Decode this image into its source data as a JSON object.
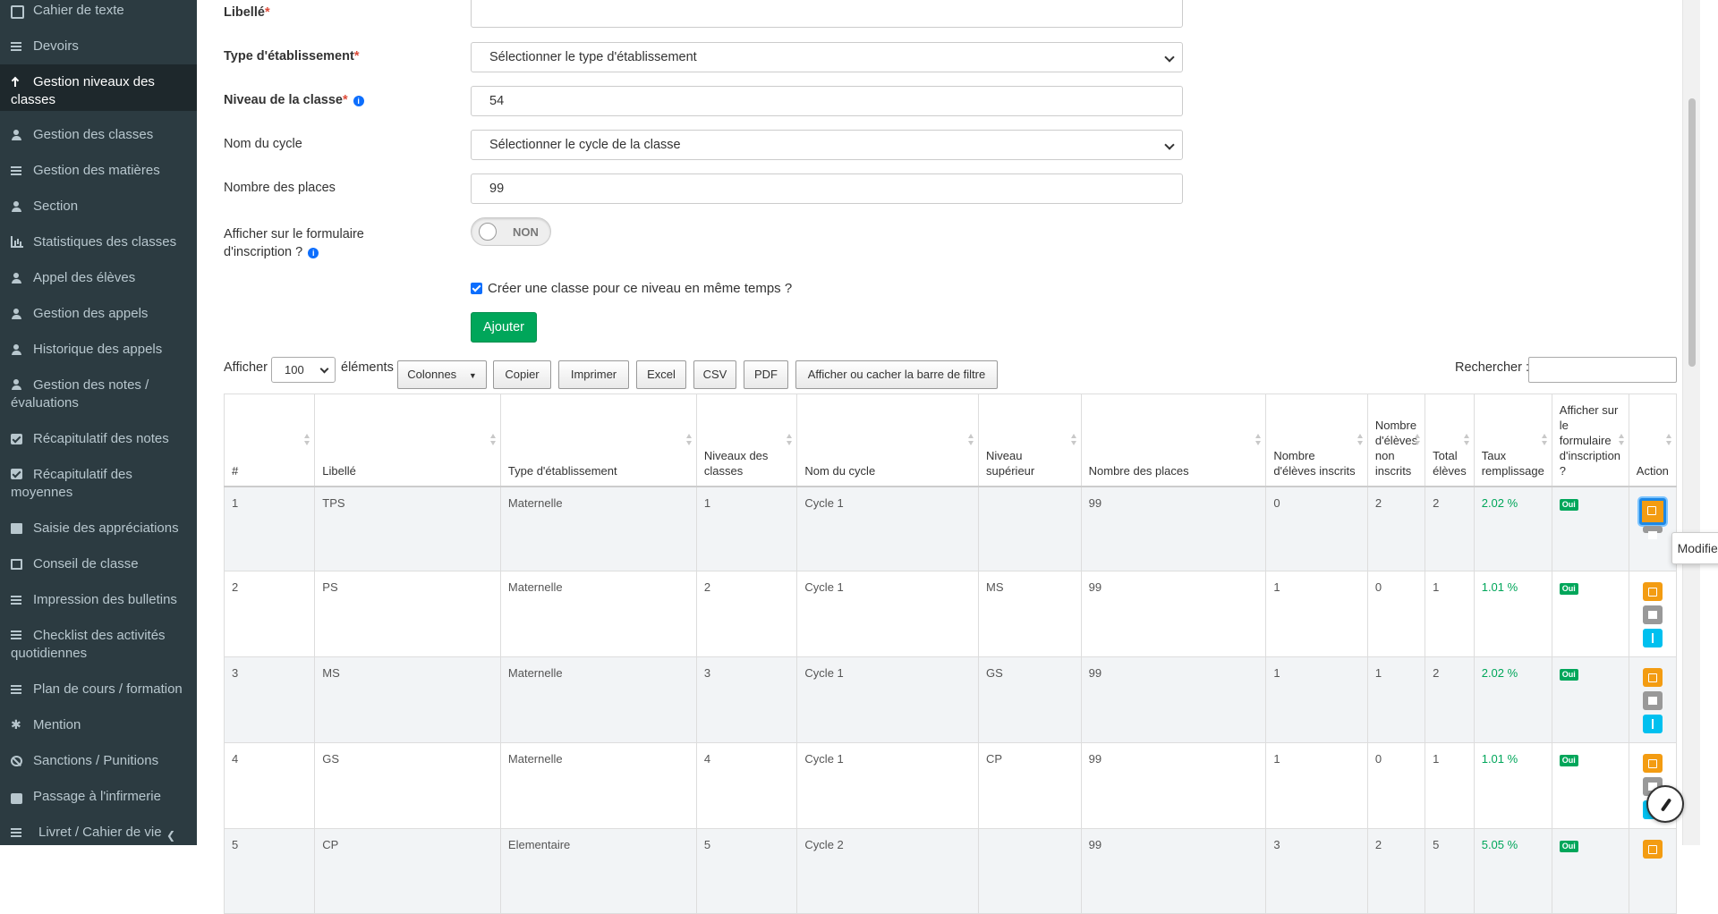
{
  "sidebar": {
    "items": [
      {
        "label": "Cahier de texte",
        "icon": "edit-icon"
      },
      {
        "label": "Devoirs",
        "icon": "list-icon"
      },
      {
        "label": "Gestion niveaux des classes",
        "icon": "level-up-icon",
        "active": true
      },
      {
        "label": "Gestion des classes",
        "icon": "sitemap-icon"
      },
      {
        "label": "Gestion des matières",
        "icon": "list-icon"
      },
      {
        "label": "Section",
        "icon": "users-icon"
      },
      {
        "label": "Statistiques des classes",
        "icon": "bar-chart-icon"
      },
      {
        "label": "Appel des élèves",
        "icon": "users-icon"
      },
      {
        "label": "Gestion des appels",
        "icon": "users-icon"
      },
      {
        "label": "Historique des appels",
        "icon": "users-icon"
      },
      {
        "label": "Gestion des notes / évaluations",
        "icon": "sitemap-icon"
      },
      {
        "label": "Récapitulatif des notes",
        "icon": "check-square-icon"
      },
      {
        "label": "Récapitulatif des moyennes",
        "icon": "check-square-icon"
      },
      {
        "label": "Saisie des appréciations",
        "icon": "file-icon"
      },
      {
        "label": "Conseil de classe",
        "icon": "file-outline-icon"
      },
      {
        "label": "Impression des bulletins",
        "icon": "list-icon"
      },
      {
        "label": "Checklist des activités quotidiennes",
        "icon": "list-icon"
      },
      {
        "label": "Plan de cours / formation",
        "icon": "list-icon"
      },
      {
        "label": "Mention",
        "icon": "asterisk-icon"
      },
      {
        "label": "Sanctions / Punitions",
        "icon": "ban-icon"
      },
      {
        "label": "Passage à l'infirmerie",
        "icon": "ambulance-icon"
      },
      {
        "label": "Livret / Cahier de vie",
        "icon": "book-icon"
      }
    ]
  },
  "form": {
    "libelle_label": "Libellé",
    "libelle_value": "",
    "type_label": "Type d'établissement",
    "type_value": "Sélectionner le type d'établissement",
    "niveau_label": "Niveau de la classe",
    "niveau_value": "54",
    "cycle_label": "Nom du cycle",
    "cycle_value": "Sélectionner le cycle de la classe",
    "places_label": "Nombre des places",
    "places_value": "99",
    "afficher_label_1": "Afficher sur le formulaire",
    "afficher_label_2": "d'inscription ?",
    "toggle_text": "NON",
    "checkbox_label": "Créer une classe pour ce niveau en même temps ?",
    "checkbox_checked": true,
    "add_button": "Ajouter",
    "required_mark": "*"
  },
  "toolbar": {
    "show_label": "Afficher",
    "length_value": "100",
    "elements_label": "éléments",
    "columns_button": "Colonnes",
    "columns_arrow": "▼",
    "copy_button": "Copier",
    "print_button": "Imprimer",
    "excel_button": "Excel",
    "csv_button": "CSV",
    "pdf_button": "PDF",
    "filter_button": "Afficher ou cacher la barre de filtre",
    "search_label": "Rechercher :",
    "search_value": ""
  },
  "table": {
    "headers": [
      "#",
      "Libellé",
      "Type d'établissement",
      "Niveaux des classes",
      "Nom du cycle",
      "Niveau supérieur",
      "Nombre des places",
      "Nombre d'élèves inscrits",
      "Nombre d'élèves non inscrits",
      "Total élèves",
      "Taux remplissage",
      "Afficher sur le formulaire d'inscription ?",
      "Action"
    ],
    "rows": [
      {
        "num": "1",
        "libelle": "TPS",
        "type": "Maternelle",
        "niveau": "1",
        "cycle": "Cycle 1",
        "superieur": "",
        "places": "99",
        "inscrits": "0",
        "non_inscrits": "2",
        "total": "2",
        "taux": "2.02 %",
        "afficher": "Oui"
      },
      {
        "num": "2",
        "libelle": "PS",
        "type": "Maternelle",
        "niveau": "2",
        "cycle": "Cycle 1",
        "superieur": "MS",
        "places": "99",
        "inscrits": "1",
        "non_inscrits": "0",
        "total": "1",
        "taux": "1.01 %",
        "afficher": "Oui"
      },
      {
        "num": "3",
        "libelle": "MS",
        "type": "Maternelle",
        "niveau": "3",
        "cycle": "Cycle 1",
        "superieur": "GS",
        "places": "99",
        "inscrits": "1",
        "non_inscrits": "1",
        "total": "2",
        "taux": "2.02 %",
        "afficher": "Oui"
      },
      {
        "num": "4",
        "libelle": "GS",
        "type": "Maternelle",
        "niveau": "4",
        "cycle": "Cycle 1",
        "superieur": "CP",
        "places": "99",
        "inscrits": "1",
        "non_inscrits": "0",
        "total": "1",
        "taux": "1.01 %",
        "afficher": "Oui"
      },
      {
        "num": "5",
        "libelle": "CP",
        "type": "Elementaire",
        "niveau": "5",
        "cycle": "Cycle 2",
        "superieur": "",
        "places": "99",
        "inscrits": "3",
        "non_inscrits": "2",
        "total": "5",
        "taux": "5.05 %",
        "afficher": "Oui"
      }
    ]
  },
  "tooltip": "Modifier",
  "colors": {
    "sidebar_bg": "#2c3b41",
    "sidebar_active_bg": "#1e282c",
    "success": "#00a65a",
    "warning": "#f39c12",
    "info": "#00c0ef",
    "required": "#dd4b39"
  }
}
